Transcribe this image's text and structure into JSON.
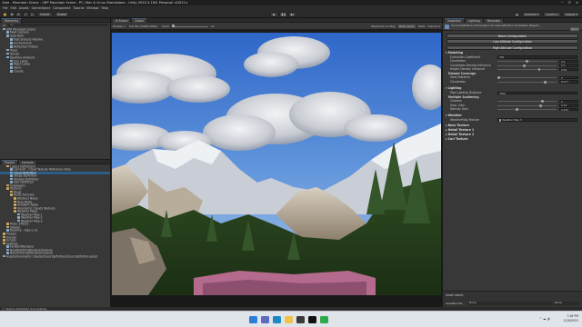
{
  "window": {
    "title": "Gaia - Mountain Scene - URP Mountain Scene - PC, Mac & Linux Standalone - Unity 2020.3.15f1 Personal <DX11>",
    "controls": "─ ☐ ✕"
  },
  "menu": [
    "File",
    "Edit",
    "Assets",
    "GameObject",
    "Component",
    "Tutorial",
    "Window",
    "Help"
  ],
  "toolbar": {
    "pivot": "Center",
    "space": "Global",
    "play": "▶",
    "pause": "❚❚",
    "step": "▶|",
    "account": "Account ▾",
    "layers": "Layers ▾",
    "layout": "Layout ▾"
  },
  "hierarchy": {
    "tab": "Hierarchy",
    "search_placeholder": "All",
    "items": [
      {
        "label": "URP Mountain Scene",
        "depth": 0,
        "selected": false
      },
      {
        "label": "Main Camera",
        "depth": 1,
        "selected": false
      },
      {
        "label": "Gaia Rest",
        "depth": 1,
        "selected": false
      },
      {
        "label": "Post-process Volume",
        "depth": 2,
        "selected": false
      },
      {
        "label": "Environment",
        "depth": 2,
        "selected": false
      },
      {
        "label": "Reflection Probes",
        "depth": 2,
        "selected": false
      },
      {
        "label": "Trees",
        "depth": 1,
        "selected": false
      },
      {
        "label": "Terrain",
        "depth": 1,
        "selected": false
      },
      {
        "label": "Daytime Ambient",
        "depth": 1,
        "selected": false
      },
      {
        "label": "Sun Lamp",
        "depth": 2,
        "selected": false
      },
      {
        "label": "Moon Lamp",
        "depth": 2,
        "selected": false
      },
      {
        "label": "Stars",
        "depth": 2,
        "selected": false
      },
      {
        "label": "Clouds",
        "depth": 2,
        "selected": false
      }
    ]
  },
  "scene_view": {
    "tabs": [
      "# Scene",
      "Game"
    ],
    "display": "Display 1",
    "resolution": "Full HD (1920x1080)",
    "scale_label": "Scale",
    "scale_value": "1x",
    "options": [
      "Maximize On Play",
      "Mute Audio",
      "Stats",
      "Gizmos ▾"
    ]
  },
  "project": {
    "tabs": [
      "Project",
      "Console"
    ],
    "items": [
      {
        "label": "Layers Definitions",
        "depth": 1,
        "folder": true,
        "selected": false
      },
      {
        "label": "Lod Instr - Cloud Texture Reference Data",
        "depth": 2,
        "folder": false,
        "selected": false
      },
      {
        "label": "Cloud Definition",
        "depth": 2,
        "folder": false,
        "selected": true
      },
      {
        "label": "Shape Definition",
        "depth": 2,
        "folder": false,
        "selected": false
      },
      {
        "label": "Studies Definition",
        "depth": 2,
        "folder": false,
        "selected": false
      },
      {
        "label": "Star Definition",
        "depth": 2,
        "folder": false,
        "selected": false
      },
      {
        "label": "Subgraphs",
        "depth": 1,
        "folder": true,
        "selected": false
      },
      {
        "label": "Textures",
        "depth": 1,
        "folder": true,
        "selected": false
      },
      {
        "label": "Blugs",
        "depth": 2,
        "folder": true,
        "selected": false
      },
      {
        "label": "Noise Textures",
        "depth": 2,
        "folder": true,
        "selected": false
      },
      {
        "label": "Abstract Noise",
        "depth": 3,
        "folder": true,
        "selected": false
      },
      {
        "label": "Blue Noise",
        "depth": 3,
        "folder": true,
        "selected": false
      },
      {
        "label": "Gradient Noise",
        "depth": 3,
        "folder": true,
        "selected": false
      },
      {
        "label": "Volumetric Clouds Textures",
        "depth": 3,
        "folder": true,
        "selected": false
      },
      {
        "label": "Weather Maps",
        "depth": 3,
        "folder": true,
        "selected": false
      },
      {
        "label": "Weather Map 1",
        "depth": 4,
        "folder": false,
        "selected": false
      },
      {
        "label": "Weather Map 2",
        "depth": 4,
        "folder": false,
        "selected": false
      },
      {
        "label": "Weather Map 3",
        "depth": 4,
        "folder": false,
        "selected": false
      },
      {
        "label": "Music Effects",
        "depth": 1,
        "folder": true,
        "selected": false
      },
      {
        "label": "Skybox",
        "depth": 1,
        "folder": true,
        "selected": false
      },
      {
        "label": "Readme - Alps v1.8",
        "depth": 1,
        "folder": false,
        "selected": false
      },
      {
        "label": "Presets",
        "depth": 0,
        "folder": true,
        "selected": false
      },
      {
        "label": "Scenes",
        "depth": 0,
        "folder": true,
        "selected": false
      },
      {
        "label": "Scripts",
        "depth": 0,
        "folder": true,
        "selected": false
      },
      {
        "label": "Settings",
        "depth": 0,
        "folder": true,
        "selected": false
      },
      {
        "label": "ForwardRenderer",
        "depth": 1,
        "folder": false,
        "selected": false
      },
      {
        "label": "NewDepthForRendererFeature",
        "depth": 1,
        "folder": false,
        "selected": false
      },
      {
        "label": "NewUniversalRendererFeature",
        "depth": 1,
        "folder": false,
        "selected": false
      },
      {
        "label": "Assets/Volumetric Clouds/Cloud Definition/Cloud Definition.asset",
        "depth": 0,
        "folder": false,
        "selected": false
      }
    ]
  },
  "inspector": {
    "tabs": [
      "Inspector",
      "Lighting",
      "Recorder"
    ],
    "header": "Cloud Definition (Volumetric Clouds Definition Scriptable Object)",
    "open_label": "Open",
    "buttons": [
      "Basic Configuration",
      "Low Altitude Configuration",
      "High Altitude Configuration"
    ],
    "modeling_title": "Modeling",
    "modeling": [
      {
        "label": "Extinction Coefficient",
        "value": "500",
        "field": true
      },
      {
        "label": "Cloudiness",
        "value": "0.5",
        "slider": 0.5
      },
      {
        "label": "Cloudiness Density Influence",
        "value": "0.5",
        "slider": 0.45
      },
      {
        "label": "Height Density Influence",
        "value": "0.64",
        "slider": 0.72
      }
    ],
    "distant_title": "Distant Coverage",
    "distant": [
      {
        "label": "Start Distance",
        "value": "0",
        "slider": 0.0
      },
      {
        "label": "Cloudiness",
        "value": "0.077",
        "slider": 0.82
      }
    ],
    "lighting_title": "Lighting",
    "lighting": [
      {
        "label": "Max Lighting Distance",
        "value": "3000",
        "field": true
      }
    ],
    "scatter_title": "Multiple Scattering",
    "scatter": [
      {
        "label": "Octaves",
        "value": "2",
        "slider": 0.78
      },
      {
        "label": "Amp. Gain",
        "value": "0.33",
        "slider": 0.74
      },
      {
        "label": "Density Gain",
        "value": "0.152",
        "slider": 0.32
      }
    ],
    "weather_title": "Weather",
    "weather_field_label": "WeatherMap Texture",
    "weather_field_value": "Weather Map 3",
    "collapsed_sections": [
      "Base Texture",
      "Detail Texture 1",
      "Detail Texture 2",
      "Curl Texture"
    ],
    "asset_labels": "Asset Labels",
    "asset_bundle_label": "AssetBundle",
    "asset_bundle_value": "None",
    "asset_bundle_variant": "None"
  },
  "status": "Skybox Initialized Successfully",
  "taskbar": {
    "time": "7:18 PM",
    "date": "12/9/2021"
  }
}
